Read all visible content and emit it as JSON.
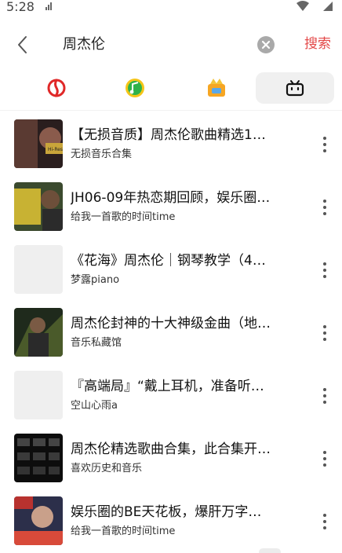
{
  "status_bar": {
    "time": "5:28",
    "icons": [
      "signal-icon",
      "wifi-icon",
      "cellular-icon"
    ]
  },
  "search": {
    "query": "周杰伦",
    "submit_label": "搜索",
    "back_icon": "chevron-left-icon",
    "clear_icon": "clear-icon"
  },
  "tabs": [
    {
      "icon": "netease-music-icon",
      "active": false
    },
    {
      "icon": "qq-music-icon",
      "active": false
    },
    {
      "icon": "kuwo-music-icon",
      "active": false
    },
    {
      "icon": "bilibili-icon",
      "active": true
    }
  ],
  "colors": {
    "accent": "#e34848",
    "tab_active_bg": "#f0f0f0",
    "placeholder": "#efefef"
  },
  "results": [
    {
      "title": "【无损音质】周杰伦歌曲精选1…",
      "subtitle": "无损音乐合集",
      "thumb": "image"
    },
    {
      "title": "JH06-09年热恋期回顾，娱乐圈…",
      "subtitle": "给我一首歌的时间time",
      "thumb": "image"
    },
    {
      "title": "《花海》周杰伦｜钢琴教学（4…",
      "subtitle": "梦露piano",
      "thumb": "placeholder"
    },
    {
      "title": "周杰伦封神的十大神级金曲（地…",
      "subtitle": "音乐私藏馆",
      "thumb": "image"
    },
    {
      "title": "『高端局』“戴上耳机，准备听…",
      "subtitle": "空山心雨a",
      "thumb": "placeholder"
    },
    {
      "title": "周杰伦精选歌曲合集，此合集开…",
      "subtitle": "喜欢历史和音乐",
      "thumb": "image"
    },
    {
      "title": "娱乐圈的BE天花板，爆肝万字…",
      "subtitle": "给我一首歌的时间time",
      "thumb": "image"
    }
  ]
}
